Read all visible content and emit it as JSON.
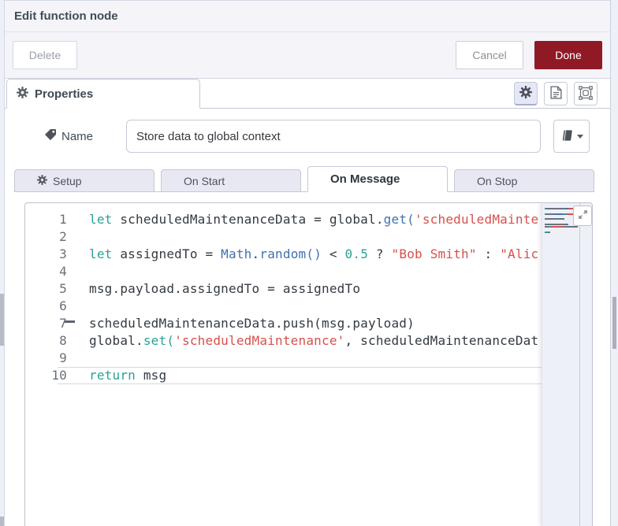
{
  "dialog": {
    "title": "Edit function node"
  },
  "actions": {
    "delete": "Delete",
    "cancel": "Cancel",
    "done": "Done"
  },
  "properties_tab": {
    "label": "Properties"
  },
  "toolbar": {
    "icons": [
      "settings-gear",
      "documentation",
      "fit-to-selection"
    ]
  },
  "name_field": {
    "label": "Name",
    "value": "Store data to global context"
  },
  "function_tabs": {
    "active": "On Message",
    "items": [
      {
        "label": "Setup"
      },
      {
        "label": "On Start"
      },
      {
        "label": "On Message"
      },
      {
        "label": "On Stop"
      }
    ]
  },
  "editor": {
    "current_line": 10,
    "colors": {
      "keyword": "#2aa198",
      "function": "#4271ae",
      "string": "#d6504e",
      "number": "#2aa198",
      "default": "#333a42"
    },
    "lines": [
      {
        "num": 1,
        "tokens": [
          {
            "c": "kw",
            "t": "let"
          },
          {
            "c": "d",
            "t": " scheduledMaintenanceData = global."
          },
          {
            "c": "fn",
            "t": "get("
          },
          {
            "c": "str",
            "t": "'scheduledMainte"
          }
        ]
      },
      {
        "num": 2,
        "tokens": []
      },
      {
        "num": 3,
        "tokens": [
          {
            "c": "kw",
            "t": "let"
          },
          {
            "c": "d",
            "t": " assignedTo = "
          },
          {
            "c": "fn",
            "t": "Math"
          },
          {
            "c": "d",
            "t": "."
          },
          {
            "c": "fn",
            "t": "random()"
          },
          {
            "c": "d",
            "t": " < "
          },
          {
            "c": "num",
            "t": "0.5"
          },
          {
            "c": "d",
            "t": " ? "
          },
          {
            "c": "str",
            "t": "\"Bob Smith\""
          },
          {
            "c": "d",
            "t": " : "
          },
          {
            "c": "str",
            "t": "\"Alic"
          }
        ]
      },
      {
        "num": 4,
        "tokens": []
      },
      {
        "num": 5,
        "tokens": [
          {
            "c": "d",
            "t": "msg.payload.assignedTo = assignedTo"
          }
        ]
      },
      {
        "num": 6,
        "tokens": []
      },
      {
        "num": 7,
        "tokens": [
          {
            "c": "d",
            "t": "scheduledMaintenanceData.push(msg.payload)"
          }
        ]
      },
      {
        "num": 8,
        "tokens": [
          {
            "c": "d",
            "t": "global."
          },
          {
            "c": "kw",
            "t": "set("
          },
          {
            "c": "str",
            "t": "'scheduledMaintenance'"
          },
          {
            "c": "d",
            "t": ", scheduledMaintenanceDat"
          }
        ]
      },
      {
        "num": 9,
        "tokens": []
      },
      {
        "num": 10,
        "tokens": [
          {
            "c": "kw",
            "t": "return"
          },
          {
            "c": "d",
            "t": " msg"
          }
        ]
      }
    ]
  },
  "colors": {
    "done_button": "#8f1a26",
    "panel_bg": "#f4f4f9",
    "tab_inactive_bg": "#e7e8f2"
  }
}
